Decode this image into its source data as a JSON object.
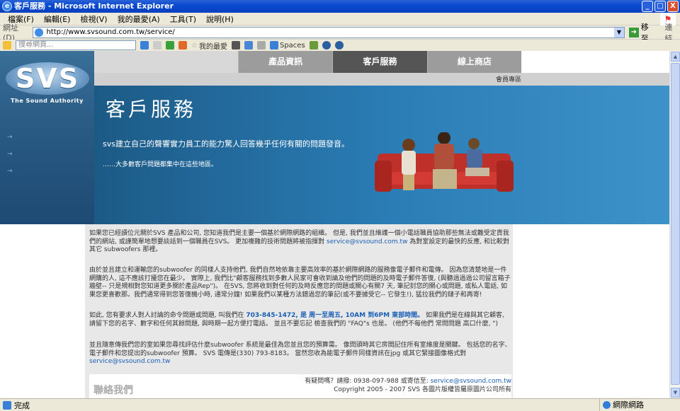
{
  "window": {
    "title": "客戶服務 - Microsoft Internet Explorer",
    "minimize": "_",
    "maximize": "□",
    "close": "X"
  },
  "menu": [
    "檔案(F)",
    "編輯(E)",
    "檢視(V)",
    "我的最愛(A)",
    "工具(T)",
    "說明(H)"
  ],
  "address": {
    "label": "網址(D)",
    "url": "http://www.svsound.com.tw/service/",
    "go": "移至",
    "links": "連結"
  },
  "toolbar": {
    "search_placeholder": "搜尋網頁...",
    "favorites": "我的最愛",
    "spaces": "Spaces"
  },
  "site": {
    "logo": "SVS",
    "tagline": "The Sound Authority",
    "nav": [
      "產品資訊",
      "客戶服務",
      "線上商店"
    ],
    "member": "會員專區",
    "hero_title": "客戶服務",
    "hero_slogan": "svs建立自己的聲響實力員工的能力驚人回答幾乎任何有關的問題發音。",
    "hero_sub": "……大多數客戶問題都集中在這些地區。",
    "p1a": "如果您已經讀位元關於SVS 產品和公司, 您知道我們是主要一個基於網際網路的組織。 但是, 我們並且維護一個小電話職員協助那些無法或難受定貨我們的網站, 或謹簡單地想要談話到一個職員在SVS。  更加複雜的技術問題將被指揮對 ",
    "p1_email": "service@svsound.com.tw",
    "p1b": " 為對室設定的最快的反應, 和比較對其它 subwoofers 那裡。",
    "p2": "由於並且建立和運輸您的subwoofer 的同樣人支持他們, 我們自然地依靠主要高效率的基於網際網路的服務像電子郵件和電傳。 因為您清楚地是一件網購的人, 這不應該打擾您在最少。 實際上, 我們比\"顧客服務找到多數人民家可會收到論及他們的問題的及時電子郵件答復, (與聽過過過公司留言箱子牆壁-- 只是規相對您知道更多關於產品Rep\")。 在SVS, 您將收到對任何的及時反應您的問題或關心有關7 天, 筆記封您的關心或問題, 或私人電話, 如果您更喜歡那。我們通常得到您答復機小時, 通常分鐘! 如果我們以某種方法錯過您的筆記(或不要據受它-- 它發生!), 猛拉我們的鏈子和再寄!",
    "p3a": "如此, 您有要求人對人討論的命令問題或問題, 叫我們在 ",
    "p3_phone": "703-845-1472, 是 周一至周五, 10AM 到6PM 東部時間。",
    "p3b": " 如果我們是在線與其它顧客, 請留下您的名字、數字和任何其餘問題, 與時期一起方便打電話。  並且不要忘記 檢查我們的 \"FAQ\"s 也是。 (他們不每他們 常問問題 高口什麼, \")",
    "p4a": "並且隨意傳我們您的室如果您尋找評估什麼subwoofer 系統是最佳為您並且您的預算需。 像問頭時其它房間記住所有室維度是關鍵。  包括您的名字、電子郵件和您提出的subwoofer 預算。  SVS 電傳是(330) 793-8183。 當然您收為能電子郵件同樣資訊在jpg 或其它緊接圖像格式對",
    "p4_email": "service@svsound.com.tw",
    "contact": "聯絡我們",
    "footer_line1a": "有疑問嗎？請撥: 0938-097-988 或寄信至: ",
    "footer_email": "service@svsound.com.tw",
    "footer_line2": "Copyright 2005 - 2007 SVS   各圖片版權皆屬原圖片公司所有"
  },
  "status": {
    "left": "完成",
    "zone": "網際網路"
  }
}
